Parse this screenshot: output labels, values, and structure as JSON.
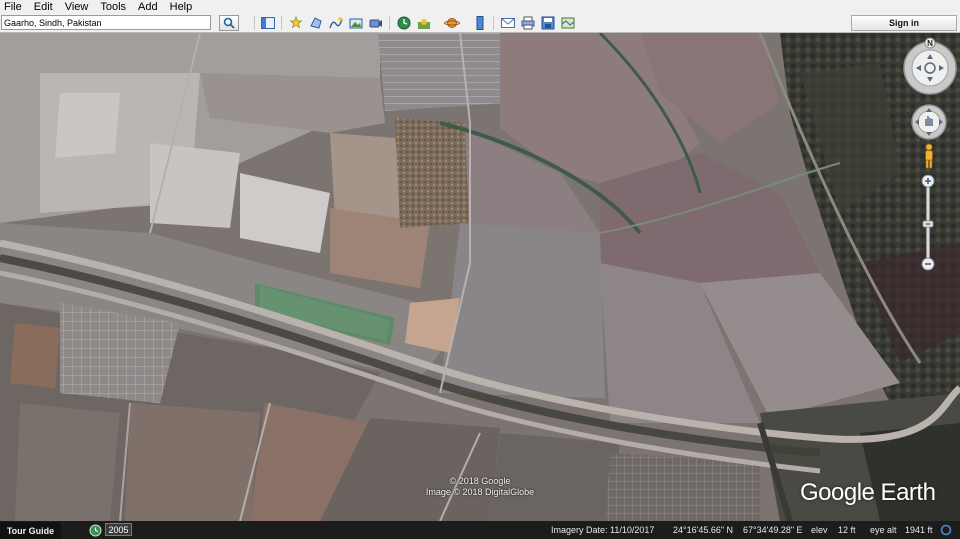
{
  "menubar": {
    "items": [
      "File",
      "Edit",
      "View",
      "Tools",
      "Add",
      "Help"
    ]
  },
  "toolbar": {
    "search_value": "Gaarho, Sindh, Pakistan",
    "signin_label": "Sign in",
    "icons": [
      "search-icon",
      "sidebar-toggle-icon",
      "add-placemark-icon",
      "add-polygon-icon",
      "add-path-icon",
      "add-image-overlay-icon",
      "record-tour-icon",
      "historical-imagery-icon",
      "sunlight-icon",
      "planets-icon",
      "ruler-icon",
      "email-icon",
      "print-icon",
      "save-image-icon",
      "view-in-maps-icon"
    ]
  },
  "map": {
    "credit_line1": "© 2018 Google",
    "credit_line2": "Image © 2018 DigitalGlobe",
    "brand": "Google Earth",
    "compass_north": "N"
  },
  "statusbar": {
    "tour_guide_label": "Tour Guide",
    "historical_year": "2005",
    "imagery_date": "Imagery Date: 11/10/2017",
    "latitude": "24°16'45.66\" N",
    "longitude": "67°34'49.28\" E",
    "elev_label": "elev",
    "elev_value": "12 ft",
    "eye_alt_label": "eye alt",
    "eye_alt_value": "1941 ft"
  },
  "colors": {
    "ui_chrome": "#f0f0f0",
    "statusbar_bg": "#1c1c1c",
    "canal_water": "#5f8a6a",
    "nav_control": "#dcdcdc"
  }
}
